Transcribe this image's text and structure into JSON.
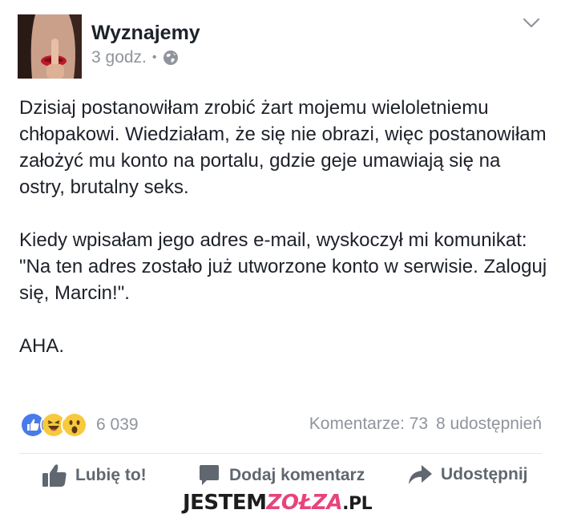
{
  "header": {
    "page_name": "Wyznajemy",
    "time": "3 godz.",
    "separator": "•",
    "privacy_icon": "globe-icon",
    "menu_icon": "chevron-down-icon"
  },
  "post": {
    "paragraphs": [
      "Dzisiaj postanowiłam zrobić żart mojemu wieloletniemu chłopakowi. Wiedziałam, że się nie obrazi, więc postanowiłam założyć mu konto na portalu, gdzie geje umawiają się na ostry, brutalny seks.",
      "Kiedy wpisałam jego adres e-mail, wyskoczył mi komunikat: \"Na ten adres zostało już utworzone konto w serwisie. Zaloguj się, Marcin!\".",
      "AHA."
    ]
  },
  "reactions": {
    "icons": [
      "like-reaction-icon",
      "haha-reaction-icon",
      "wow-reaction-icon"
    ],
    "count": "6 039",
    "comments": "Komentarze: 73",
    "shares": "8 udostępnień"
  },
  "actions": {
    "like": "Lubię to!",
    "comment": "Dodaj komentarz",
    "share": "Udostępnij"
  },
  "watermark": {
    "part1": "JESTEM",
    "part2": "ZOŁZA",
    "part3": ".PL"
  },
  "colors": {
    "text": "#1d2129",
    "muted": "#90949c",
    "action": "#606770",
    "like_blue": "#4a7ae8",
    "reaction_yellow": "#f7c93c",
    "watermark_pink": "#e8437b"
  }
}
